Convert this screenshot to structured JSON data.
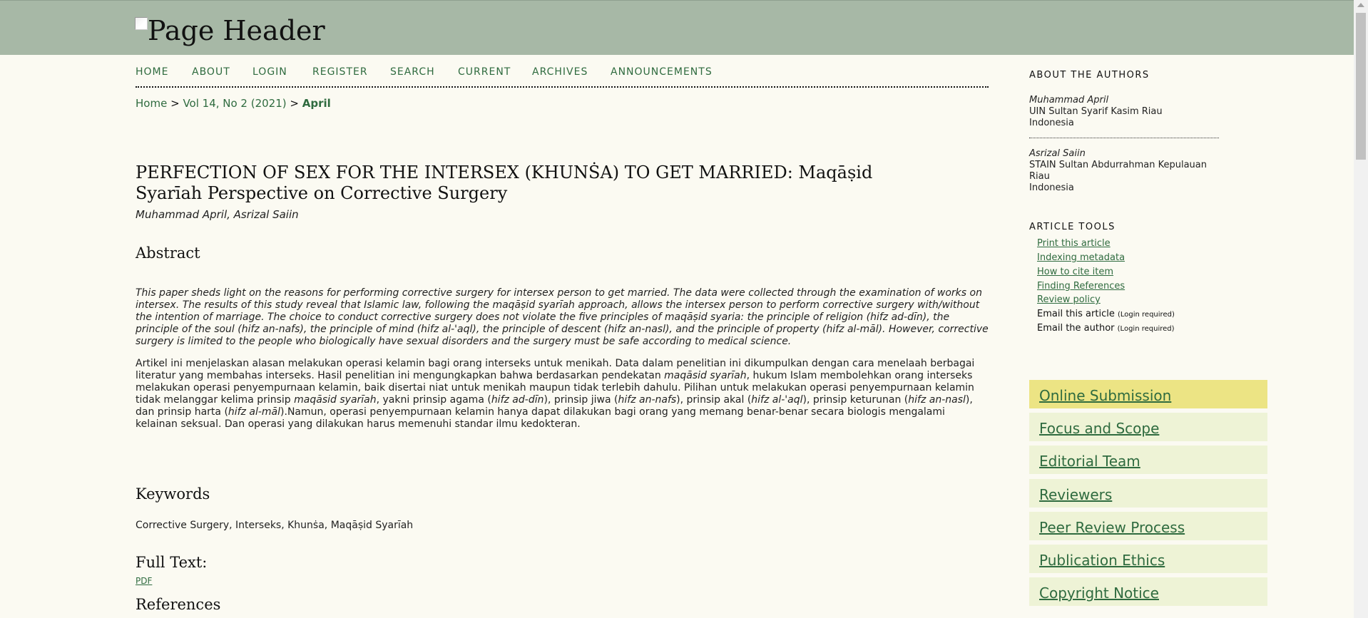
{
  "header": {
    "title": "Page Header"
  },
  "nav": {
    "items": [
      "HOME",
      "ABOUT",
      "LOGIN",
      "REGISTER",
      "SEARCH",
      "CURRENT",
      "ARCHIVES",
      "ANNOUNCEMENTS"
    ]
  },
  "breadcrumb": {
    "home": "Home",
    "sep1": ">",
    "issue": "Vol 14, No 2 (2021)",
    "sep2": ">",
    "current": "April"
  },
  "article": {
    "title": "PERFECTION OF SEX FOR THE INTERSEX (KHUNṠA) TO GET MARRIED: Maqāṣid Syarīah Perspective on Corrective Surgery",
    "authors": "Muhammad April, Asrizal Saiin",
    "abstract_heading": "Abstract",
    "abstract_en": "This paper sheds light on the reasons for performing corrective surgery for intersex person to get married. The data were collected through the examination of works on intersex. The results of this study reveal that Islamic law, following the maqāṣid syarīah approach, allows the intersex person to perform corrective surgery with/without the intention of marriage. The choice to conduct corrective surgery does not violate the five principles of maqāṣid syaria: the principle of religion (hifz ad-dīn), the principle of the soul (hifz an-nafs), the principle of mind (hifz al-'aql), the principle of descent (hifz an-nasl), and the principle of property (hifz al-māl).  However, corrective surgery is limited to the people who biologically have sexual disorders and the surgery must be safe according to medical science.",
    "abstract_id": {
      "p1": "Artikel ini menjelaskan alasan melakukan operasi kelamin bagi orang interseks untuk menikah. Data dalam penelitian ini dikumpulkan dengan cara menelaah berbagai literatur yang membahas interseks. Hasil penelitian ini mengungkapkan bahwa berdasarkan pendekatan ",
      "i1": "maqāsid syarīah",
      "p2": ", hukum Islam membolehkan orang interseks melakukan operasi penyempurnaan kelamin, baik disertai niat untuk menikah maupun tidak terlebih dahulu. Pilihan untuk melakukan operasi penyempurnaan kelamin tidak melanggar kelima prinsip ",
      "i2": "maqāsid syarīah",
      "p3": ", yakni prinsip agama (",
      "i3": "hifz ad-dīn",
      "p4": "), prinsip jiwa (",
      "i4": "hifz an-nafs",
      "p5": "), prinsip akal (",
      "i5": "hifz al-'aql",
      "p6": "), prinsip keturunan (",
      "i6": "hifz an-nasl",
      "p7": "), dan prinsip harta (",
      "i7": "hifz al-māl",
      "p8": ").Namun, operasi penyempurnaan kelamin hanya dapat dilakukan bagi orang yang memang benar-benar secara biologis mengalami kelainan seksual. Dan operasi yang dilakukan harus memenuhi standar ilmu kedokteran."
    },
    "keywords_heading": "Keywords",
    "keywords": "Corrective Surgery, Interseks, Khunṡa, Maqāṣid Syarīah",
    "fulltext_heading": "Full Text:",
    "pdf_label": "PDF",
    "references_heading": "References"
  },
  "sidebar": {
    "about_heading": "ABOUT THE AUTHORS",
    "author1": {
      "name": "Muhammad April",
      "affiliation": "UIN Sultan Syarif Kasim Riau",
      "country": "Indonesia"
    },
    "author2": {
      "name": "Asrizal Saiin",
      "affiliation": "STAIN Sultan Abdurrahman Kepulauan Riau",
      "country": "Indonesia"
    },
    "tools_heading": "ARTICLE TOOLS",
    "tools": {
      "print": "Print this article",
      "indexing": "Indexing metadata",
      "cite": "How to cite item",
      "refs": "Finding References",
      "review": "Review policy",
      "email_article": "Email this article",
      "email_author": "Email the author",
      "login_required": "(Login required)"
    },
    "menu": [
      "Online Submission",
      "Focus and Scope",
      "Editorial Team",
      "Reviewers",
      "Peer Review Process",
      "Publication Ethics",
      "Copyright Notice"
    ]
  },
  "colors": {
    "header_bg": "#a7b8a6",
    "link": "#2f6b3f",
    "page_bg": "#fbfaf2",
    "menu_bg": "#eef3d6",
    "menu_highlight": "#ece484"
  }
}
